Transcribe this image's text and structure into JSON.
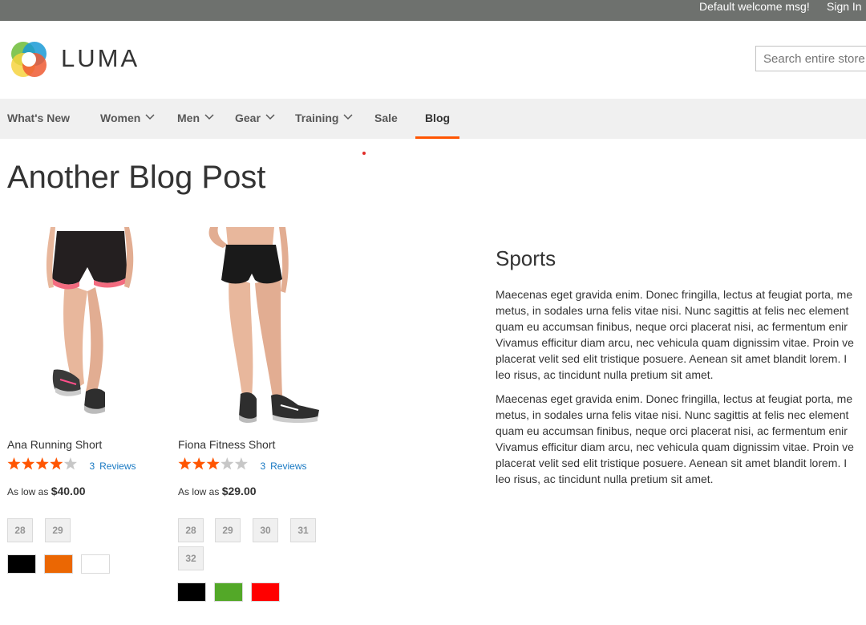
{
  "header": {
    "welcome": "Default welcome msg!",
    "sign_in": "Sign In",
    "logo_text": "LUMA",
    "search_placeholder": "Search entire store here..."
  },
  "nav": {
    "items": [
      {
        "label": "What's New",
        "has_dropdown": false
      },
      {
        "label": "Women",
        "has_dropdown": true
      },
      {
        "label": "Men",
        "has_dropdown": true
      },
      {
        "label": "Gear",
        "has_dropdown": true
      },
      {
        "label": "Training",
        "has_dropdown": true
      },
      {
        "label": "Sale",
        "has_dropdown": false
      },
      {
        "label": "Blog",
        "has_dropdown": false,
        "active": true
      }
    ]
  },
  "page": {
    "title": "Another Blog Post"
  },
  "products": [
    {
      "name": "Ana Running Short",
      "rating_stars": 4,
      "rating_max": 5,
      "review_count": "3",
      "reviews_label": "Reviews",
      "price_prefix": "As low as",
      "price": "$40.00",
      "sizes": [
        "28",
        "29"
      ],
      "colors": [
        "#000000",
        "#eb6703",
        "#ffffff"
      ]
    },
    {
      "name": "Fiona Fitness Short",
      "rating_stars": 3,
      "rating_max": 5,
      "review_count": "3",
      "reviews_label": "Reviews",
      "price_prefix": "As low as",
      "price": "$29.00",
      "sizes": [
        "28",
        "29",
        "30",
        "31",
        "32"
      ],
      "colors": [
        "#000000",
        "#53a828",
        "#ff0000"
      ]
    }
  ],
  "article": {
    "heading": "Sports",
    "paragraphs": [
      [
        "Maecenas eget gravida enim. Donec fringilla, lectus at feugiat porta, me",
        "metus, in sodales urna felis vitae nisi. Nunc sagittis at felis nec element",
        "quam eu accumsan finibus, neque orci placerat nisi, ac fermentum enir",
        "Vivamus efficitur diam arcu, nec vehicula quam dignissim vitae. Proin ve",
        "placerat velit sed elit tristique posuere. Aenean sit amet blandit lorem. I",
        "leo risus, ac tincidunt nulla pretium sit amet."
      ],
      [
        "Maecenas eget gravida enim. Donec fringilla, lectus at feugiat porta, me",
        "metus, in sodales urna felis vitae nisi. Nunc sagittis at felis nec element",
        "quam eu accumsan finibus, neque orci placerat nisi, ac fermentum enir",
        "Vivamus efficitur diam arcu, nec vehicula quam dignissim vitae. Proin ve",
        "placerat velit sed elit tristique posuere. Aenean sit amet blandit lorem. I",
        "leo risus, ac tincidunt nulla pretium sit amet."
      ]
    ]
  },
  "colors": {
    "accent": "#ff5501",
    "star": "#ff5501",
    "link": "#1979c3",
    "topbar": "#6e716e"
  }
}
